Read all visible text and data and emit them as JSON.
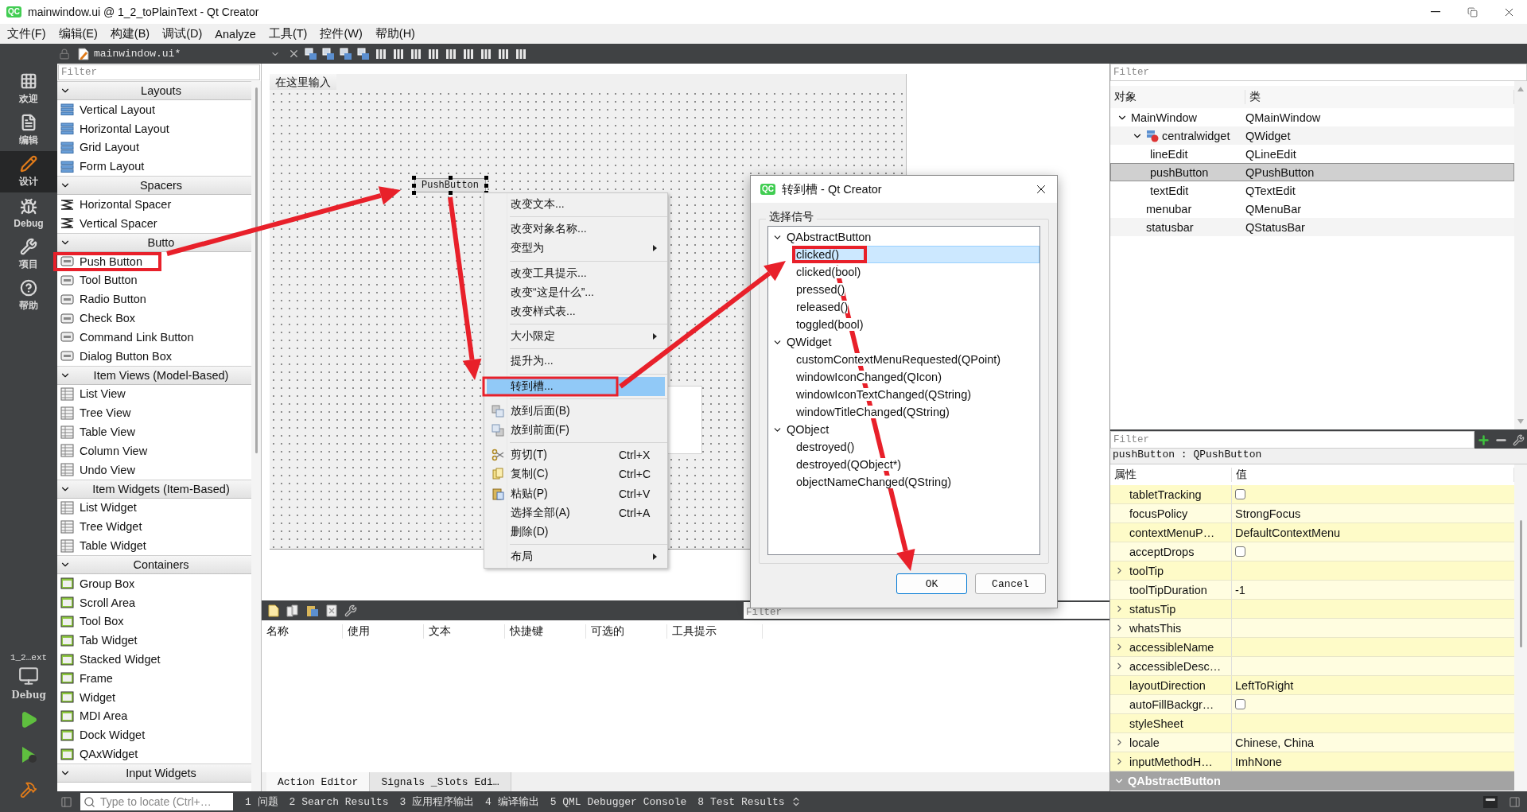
{
  "window": {
    "logo": "QC",
    "title": "mainwindow.ui @ 1_2_toPlainText - Qt Creator"
  },
  "menu_bar": [
    "文件(F)",
    "编辑(E)",
    "构建(B)",
    "调试(D)",
    "Analyze",
    "工具(T)",
    "控件(W)",
    "帮助(H)"
  ],
  "editor_toolbar": {
    "file": "mainwindow.ui*"
  },
  "modes": [
    {
      "label": "欢迎",
      "selected": false
    },
    {
      "label": "编辑",
      "selected": false
    },
    {
      "label": "设计",
      "selected": true
    },
    {
      "label": "Debug",
      "selected": false
    },
    {
      "label": "项目",
      "selected": false
    },
    {
      "label": "帮助",
      "selected": false
    }
  ],
  "target": {
    "project": "1_2…ext",
    "config": "Debug"
  },
  "widget_box": {
    "filter_placeholder": "Filter",
    "categories": [
      {
        "label": "Layouts",
        "expanded": true,
        "items": [
          "Vertical Layout",
          "Horizontal Layout",
          "Grid Layout",
          "Form Layout"
        ]
      },
      {
        "label": "Spacers",
        "expanded": true,
        "items": [
          "Horizontal Spacer",
          "Vertical Spacer"
        ]
      },
      {
        "label": "Butto",
        "expanded": true,
        "items": [
          "Push Button",
          "Tool Button",
          "Radio Button",
          "Check Box",
          "Command Link Button",
          "Dialog Button Box"
        ]
      },
      {
        "label": "Item Views (Model-Based)",
        "expanded": true,
        "items": [
          "List View",
          "Tree View",
          "Table View",
          "Column View",
          "Undo View"
        ]
      },
      {
        "label": "Item Widgets (Item-Based)",
        "expanded": true,
        "items": [
          "List Widget",
          "Tree Widget",
          "Table Widget"
        ]
      },
      {
        "label": "Containers",
        "expanded": true,
        "items": [
          "Group Box",
          "Scroll Area",
          "Tool Box",
          "Tab Widget",
          "Stacked Widget",
          "Frame",
          "Widget",
          "MDI Area",
          "Dock Widget",
          "QAxWidget"
        ]
      },
      {
        "label": "Input Widgets",
        "expanded": true
      }
    ]
  },
  "form": {
    "menu_placeholder": "在这里输入",
    "widgets": [
      {
        "kind": "button",
        "text": "PushButton",
        "selected": true
      },
      {
        "kind": "text_edit",
        "selected": false
      }
    ]
  },
  "action_editor": {
    "filter_placeholder": "Filter",
    "columns": [
      "名称",
      "使用",
      "文本",
      "快捷键",
      "可选的",
      "工具提示"
    ],
    "tabs": [
      {
        "label": "Action Editor",
        "selected": true
      },
      {
        "label": "Signals _Slots Edi…",
        "selected": false
      }
    ]
  },
  "context_menu": {
    "items": [
      {
        "kind": "item",
        "label": "改变文本...",
        "selected": false
      },
      {
        "kind": "separator"
      },
      {
        "kind": "item",
        "label": "改变对象名称...",
        "selected": false
      },
      {
        "kind": "submenu",
        "label": "变型为",
        "selected": false
      },
      {
        "kind": "separator"
      },
      {
        "kind": "item",
        "label": "改变工具提示...",
        "selected": false
      },
      {
        "kind": "item",
        "label": "改变“这是什么”...",
        "selected": false
      },
      {
        "kind": "item",
        "label": "改变样式表...",
        "selected": false
      },
      {
        "kind": "separator"
      },
      {
        "kind": "submenu",
        "label": "大小限定",
        "selected": false
      },
      {
        "kind": "separator"
      },
      {
        "kind": "item",
        "label": "提升为...",
        "selected": false
      },
      {
        "kind": "separator"
      },
      {
        "kind": "item",
        "label": "转到槽...",
        "selected": true
      },
      {
        "kind": "separator"
      },
      {
        "kind": "icon_item",
        "label": "放到后面(B)",
        "selected": false
      },
      {
        "kind": "icon_item",
        "label": "放到前面(F)",
        "selected": false
      },
      {
        "kind": "separator"
      },
      {
        "kind": "icon_item",
        "label": "剪切(T)",
        "shortcut": "Ctrl+X",
        "selected": false
      },
      {
        "kind": "icon_item",
        "label": "复制(C)",
        "shortcut": "Ctrl+C",
        "selected": false
      },
      {
        "kind": "icon_item",
        "label": "粘贴(P)",
        "shortcut": "Ctrl+V",
        "selected": false
      },
      {
        "kind": "item",
        "label": "选择全部(A)",
        "shortcut": "Ctrl+A",
        "selected": false
      },
      {
        "kind": "item",
        "label": "删除(D)",
        "selected": false
      },
      {
        "kind": "separator"
      },
      {
        "kind": "submenu",
        "label": "布局",
        "selected": false
      }
    ]
  },
  "dialog": {
    "logo": "QC",
    "title": "转到槽 - Qt Creator",
    "group_label": "选择信号",
    "signals": [
      {
        "label": "QAbstractButton",
        "expanded": true,
        "children": [
          {
            "label": "clicked()",
            "selected": true
          },
          {
            "label": "clicked(bool)",
            "selected": false
          },
          {
            "label": "pressed()",
            "selected": false
          },
          {
            "label": "released()",
            "selected": false
          },
          {
            "label": "toggled(bool)",
            "selected": false
          }
        ]
      },
      {
        "label": "QWidget",
        "expanded": true,
        "children": [
          {
            "label": "customContextMenuRequested(QPoint)",
            "selected": false
          },
          {
            "label": "windowIconChanged(QIcon)",
            "selected": false
          },
          {
            "label": "windowIconTextChanged(QString)",
            "selected": false
          },
          {
            "label": "windowTitleChanged(QString)",
            "selected": false
          }
        ]
      },
      {
        "label": "QObject",
        "expanded": true,
        "children": [
          {
            "label": "destroyed()",
            "selected": false
          },
          {
            "label": "destroyed(QObject*)",
            "selected": false
          },
          {
            "label": "objectNameChanged(QString)",
            "selected": false
          }
        ]
      }
    ],
    "buttons": [
      {
        "label": "OK",
        "default": true
      },
      {
        "label": "Cancel",
        "default": false
      }
    ]
  },
  "object_inspector": {
    "filter_placeholder": "Filter",
    "columns": [
      "对象",
      "类"
    ],
    "objects": [
      {
        "name": "MainWindow",
        "class": "QMainWindow",
        "expanded": true,
        "selected": false,
        "children": [
          {
            "name": "centralwidget",
            "class": "QWidget",
            "expanded": true,
            "selected": false,
            "children": [
              {
                "name": "lineEdit",
                "class": "QLineEdit",
                "selected": false
              },
              {
                "name": "pushButton",
                "class": "QPushButton",
                "selected": true
              },
              {
                "name": "textEdit",
                "class": "QTextEdit",
                "selected": false
              }
            ]
          },
          {
            "name": "menubar",
            "class": "QMenuBar",
            "selected": false
          },
          {
            "name": "statusbar",
            "class": "QStatusBar",
            "selected": false
          }
        ]
      }
    ]
  },
  "property_editor": {
    "filter_placeholder": "Filter",
    "object": "pushButton : QPushButton",
    "columns": [
      "属性",
      "值"
    ],
    "rows": [
      {
        "name": "tabletTracking",
        "kind": "check",
        "checked": false,
        "expandable": false
      },
      {
        "name": "focusPolicy",
        "kind": "text",
        "value": "StrongFocus",
        "expandable": false
      },
      {
        "name": "contextMenuP…",
        "kind": "text",
        "value": "DefaultContextMenu",
        "expandable": false
      },
      {
        "name": "acceptDrops",
        "kind": "check",
        "checked": false,
        "expandable": false
      },
      {
        "name": "toolTip",
        "kind": "empty",
        "expandable": true
      },
      {
        "name": "toolTipDuration",
        "kind": "text",
        "value": "-1",
        "expandable": false
      },
      {
        "name": "statusTip",
        "kind": "empty",
        "expandable": true
      },
      {
        "name": "whatsThis",
        "kind": "empty",
        "expandable": true
      },
      {
        "name": "accessibleName",
        "kind": "empty",
        "expandable": true
      },
      {
        "name": "accessibleDesc…",
        "kind": "empty",
        "expandable": true
      },
      {
        "name": "layoutDirection",
        "kind": "text",
        "value": "LeftToRight",
        "expandable": false
      },
      {
        "name": "autoFillBackgr…",
        "kind": "check",
        "checked": false,
        "expandable": false
      },
      {
        "name": "styleSheet",
        "kind": "empty",
        "expandable": false
      },
      {
        "name": "locale",
        "kind": "text",
        "value": "Chinese, China",
        "expandable": true
      },
      {
        "name": "inputMethodH…",
        "kind": "text",
        "value": "ImhNone",
        "expandable": true
      }
    ],
    "group": {
      "label": "QAbstractButton",
      "expanded": true
    }
  },
  "status_bar": {
    "locator_placeholder": "Type to locate (Ctrl+…",
    "tabs": [
      "1 问题",
      "2 Search Results",
      "3 应用程序输出",
      "4 编译输出",
      "5 QML Debugger Console",
      "8 Test Results"
    ]
  }
}
